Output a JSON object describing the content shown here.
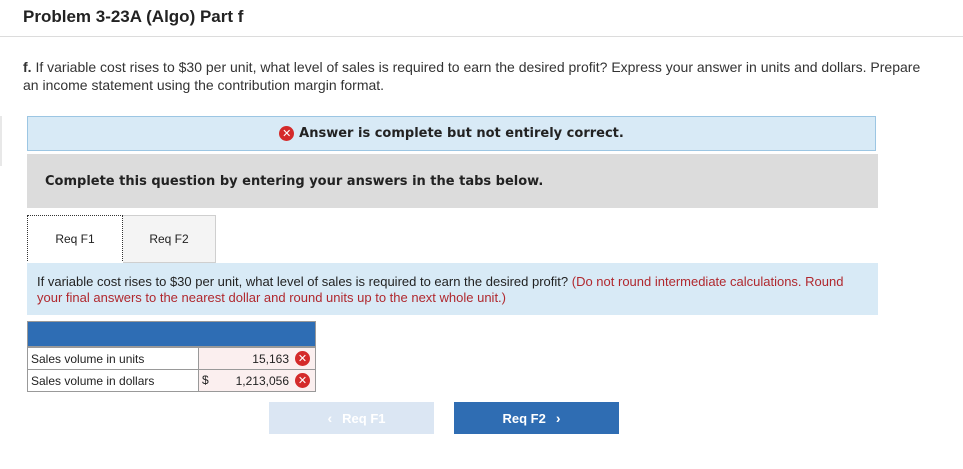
{
  "header": {
    "title": "Problem 3-23A (Algo) Part f"
  },
  "question": {
    "label": "f.",
    "text": "If variable cost rises to $30 per unit, what level of sales is required to earn the desired profit? Express your answer in units and dollars. Prepare an income statement using the contribution margin format."
  },
  "banner": {
    "icon": "x-circle-icon",
    "text": "Answer is complete but not entirely correct."
  },
  "instructions": {
    "text": "Complete this question by entering your answers in the tabs below."
  },
  "tabs": [
    {
      "label": "Req F1",
      "active": true
    },
    {
      "label": "Req F2",
      "active": false
    }
  ],
  "panel": {
    "text": "If variable cost rises to $30 per unit, what level of sales is required to earn the desired profit?",
    "note": "(Do not round intermediate calculations. Round your final answers to the nearest dollar and round units up to the next whole unit.)"
  },
  "table": {
    "rows": [
      {
        "label": "Sales volume in units",
        "prefix": "",
        "value": "15,163",
        "status": "incorrect"
      },
      {
        "label": "Sales volume in dollars",
        "prefix": "$",
        "value": "1,213,056",
        "status": "incorrect"
      }
    ]
  },
  "nav": {
    "prev_label": "Req F1",
    "next_label": "Req F2"
  },
  "colors": {
    "accent": "#2f6db3",
    "error": "#d42a2a",
    "note_red": "#b0282e",
    "banner_bg": "#d8eaf6"
  }
}
